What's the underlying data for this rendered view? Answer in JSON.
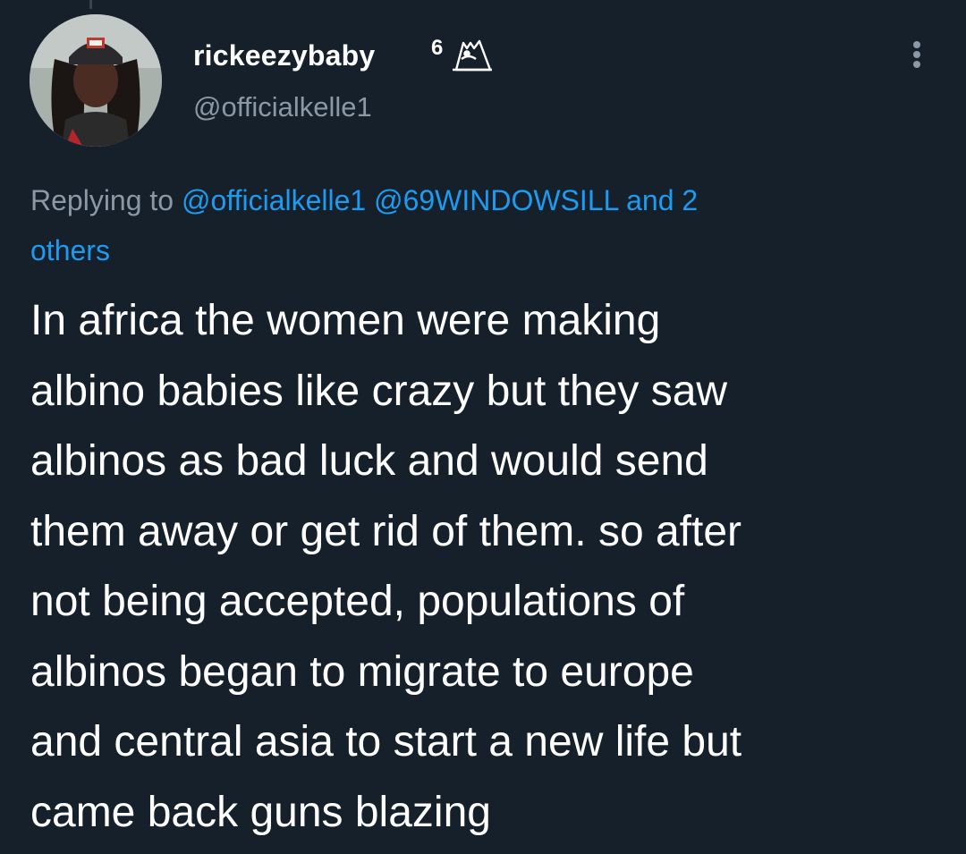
{
  "author": {
    "display_name": "rickeezybaby",
    "badge_text": "6",
    "handle": "@officialkelle1"
  },
  "reply": {
    "prefix": "Replying to",
    "mention1": "@officialkelle1",
    "mention2": "@69WINDOWSILL",
    "more_line1": "and 2",
    "more_line2": "others"
  },
  "tweet": {
    "lines": [
      "In africa the women were making",
      "albino babies like crazy but they saw",
      "albinos as bad luck and would send",
      "them away or get rid of them. so after",
      "not being accepted, populations of",
      "albinos began to migrate to europe",
      "and central asia to start a new life but",
      "came back guns blazing"
    ]
  },
  "icons": {
    "more": "more-options-icon",
    "badge": "owl-emoji-icon"
  },
  "colors": {
    "background": "#15202b",
    "text_primary": "#ffffff",
    "text_secondary": "#8b98a5",
    "link": "#1d9bf0"
  }
}
